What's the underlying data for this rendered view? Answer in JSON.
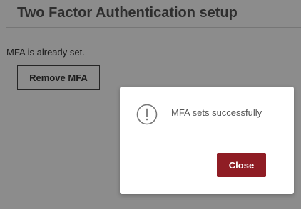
{
  "page": {
    "title": "Two Factor Authentication setup",
    "status_text": "MFA is already set.",
    "remove_button_label": "Remove MFA"
  },
  "modal": {
    "icon": "exclamation-circle-icon",
    "message": "MFA sets successfully",
    "close_button_label": "Close"
  },
  "colors": {
    "accent": "#8f1d24",
    "title_text": "#555555",
    "overlay": "rgba(0,0,0,0.45)"
  }
}
